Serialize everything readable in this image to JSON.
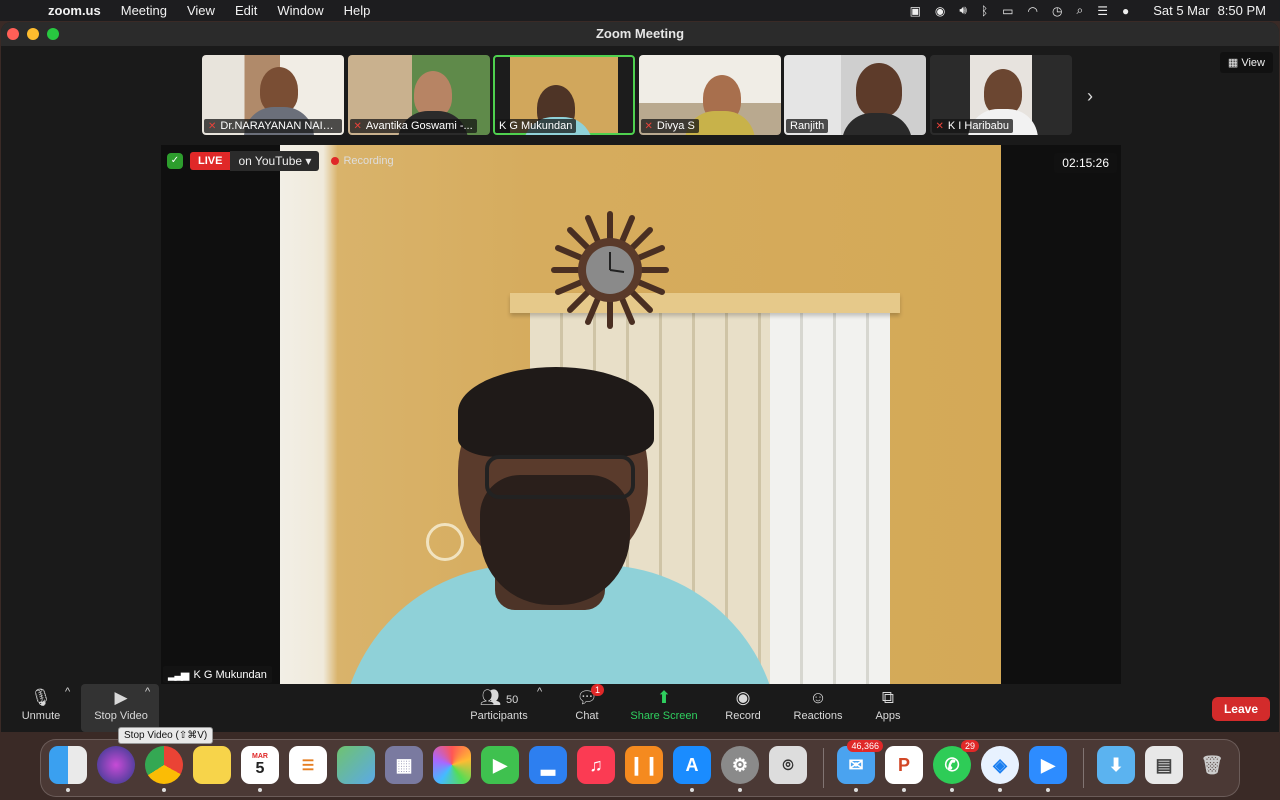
{
  "menubar": {
    "app_name": "zoom.us",
    "menus": [
      "Meeting",
      "View",
      "Edit",
      "Window",
      "Help"
    ],
    "date": "Sat 5 Mar",
    "time": "8:50 PM"
  },
  "window": {
    "title": "Zoom Meeting"
  },
  "participants_strip": [
    {
      "name": "Dr.NARAYANAN NAIR...",
      "muted": true
    },
    {
      "name": "Avantika Goswami -...",
      "muted": true
    },
    {
      "name": "K G Mukundan",
      "muted": false,
      "active": true
    },
    {
      "name": "Divya S",
      "muted": true
    },
    {
      "name": "Ranjith",
      "muted": false
    },
    {
      "name": "K I Haribabu",
      "muted": true
    }
  ],
  "view_button": "View",
  "stream": {
    "live_label": "LIVE",
    "platform": "on YouTube",
    "recording_label": "Recording",
    "timer": "02:15:26",
    "speaker_name": "K G Mukundan"
  },
  "toolbar": {
    "unmute": "Unmute",
    "stop_video": "Stop Video",
    "participants": "Participants",
    "participants_count": "50",
    "chat": "Chat",
    "chat_badge": "1",
    "share_screen": "Share Screen",
    "record": "Record",
    "reactions": "Reactions",
    "apps": "Apps",
    "leave": "Leave",
    "tooltip": "Stop Video (⇧⌘V)"
  },
  "dock": {
    "calendar_month": "MAR",
    "calendar_day": "5",
    "mail_badge": "46,366",
    "whatsapp_badge": "29"
  }
}
